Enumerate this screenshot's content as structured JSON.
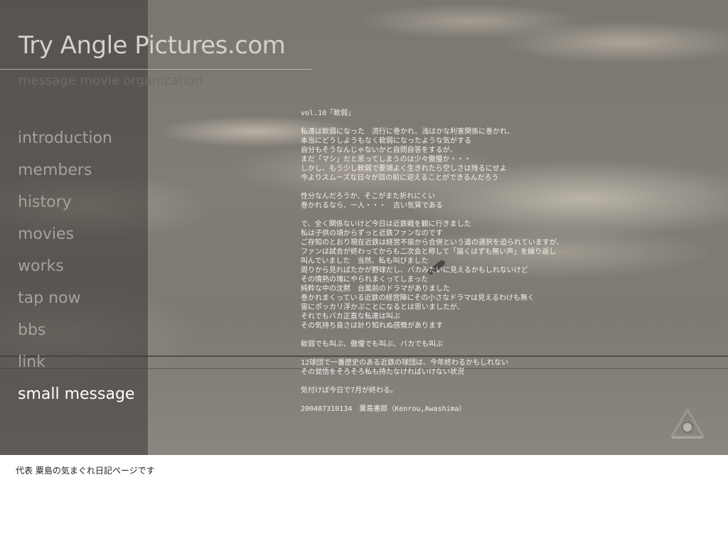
{
  "header": {
    "site_title": "Try Angle Pictures.com",
    "tagline": "message movie organization"
  },
  "nav": {
    "items": [
      {
        "label": "introduction",
        "active": false
      },
      {
        "label": "members",
        "active": false
      },
      {
        "label": "history",
        "active": false
      },
      {
        "label": "movies",
        "active": false
      },
      {
        "label": "works",
        "active": false
      },
      {
        "label": "tap now",
        "active": false
      },
      {
        "label": "bbs",
        "active": false
      },
      {
        "label": "link",
        "active": false
      },
      {
        "label": "small message",
        "active": true
      }
    ]
  },
  "post": {
    "lines": [
      "vol.10「軟弱」",
      "",
      "私達は軟弱になった　流行に巻かれ、浅はかな利害関係に巻かれ、",
      "本当にどうしようもなく軟弱になったような気がする",
      "自分もそうなんじゃないかと自問自答をするが、",
      "まだ「マシ」だと思ってしまうのは少々傲慢か・・・",
      "しかし、もう少し軟弱で要領よく生きれたら空しさは残るにせよ",
      "今よりスムーズな日々が目の前に迎えることができるんだろう",
      "",
      "性分なんだろうか、そこがまた折れにくい",
      "巻かれるなら、一人・・・　古い気質である",
      "",
      "で、全く関係ないけど今日は近鉄戦を観に行きました",
      "私は子供の頃からずっと近鉄ファンなのです",
      "ご存知のとおり現在近鉄は経営不振から合併という道の選択を迫られていますが、",
      "ファンは試合が終わってからも二次会と称して「届くはずも無い声」を繰り返し",
      "叫んでいました　当然、私も叫びました",
      "周りから見ればたかが野球だし、バカみたいに見えるかもしれないけど",
      "その情熱の塊にやられまくってしまった",
      "純粋な中の沈黙　台風前のドラマがありました",
      "巻かれまくっている近鉄の経営陣にその小さなドラマは見えるわけも無く",
      "宙にポッカリ浮かぶことになるとは思いましたが、",
      "それでもバカ正直な私達は叫ぶ",
      "その気持ち良さは計り知れぬ感慨があります",
      "",
      "軟弱でも叫ぶ、傲慢でも叫ぶ、バカでも叫ぶ",
      "",
      "12球団で一番歴史のある近鉄の球団は、今年終わるかもしれない",
      "その覚悟をそろそろ私も持たなければいけない状況",
      "",
      "気付けば今日で7月が終わる。",
      "",
      "200407310134　粟島憲郎（Kenrou,Awashima）"
    ]
  },
  "footer": {
    "text": "代表 粟島の気まぐれ日記ページです"
  },
  "icons": {
    "logo": "triangle-eye-icon"
  },
  "colors": {
    "nav_inactive": "#a5a19b",
    "nav_active": "#ffffff",
    "title": "#d4d1cc",
    "tagline": "#6f6b66"
  }
}
